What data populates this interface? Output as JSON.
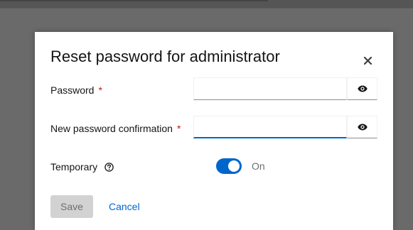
{
  "modal": {
    "title": "Reset password for administrator",
    "close_icon": "close-icon"
  },
  "fields": {
    "password": {
      "label": "Password",
      "required_mark": "*",
      "value": "",
      "icon": "eye-icon"
    },
    "confirmation": {
      "label": "New password confirmation",
      "required_mark": "*",
      "value": "",
      "icon": "eye-icon"
    },
    "temporary": {
      "label": "Temporary",
      "help_icon": "help-circle-icon",
      "state_label": "On",
      "checked": true
    }
  },
  "actions": {
    "save_label": "Save",
    "cancel_label": "Cancel"
  },
  "colors": {
    "primary": "#0066cc",
    "required": "#c9190b",
    "backdrop": "#6a6a6a",
    "disabled_button": "#d2d2d2"
  }
}
